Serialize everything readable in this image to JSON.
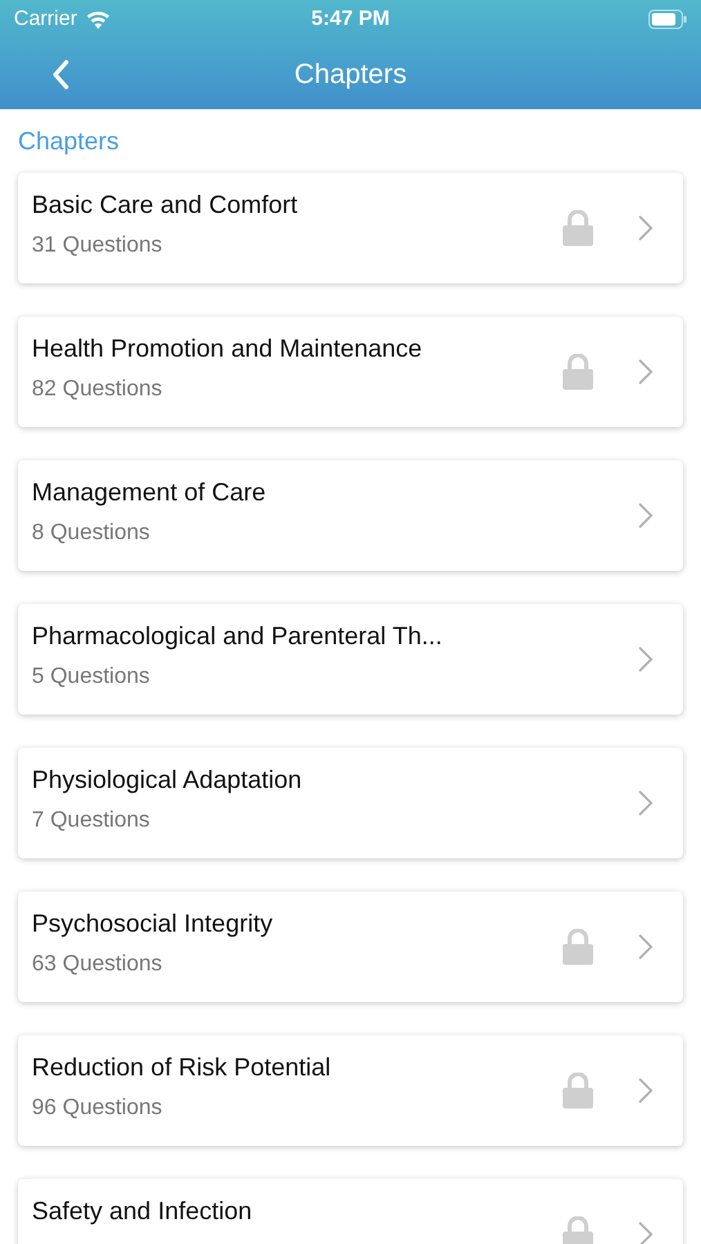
{
  "status_bar": {
    "carrier": "Carrier",
    "time": "5:47 PM"
  },
  "nav": {
    "title": "Chapters"
  },
  "section_title": "Chapters",
  "chapters": [
    {
      "title": "Basic Care and Comfort",
      "count": "31 Questions",
      "locked": true
    },
    {
      "title": "Health Promotion and Maintenance",
      "count": "82 Questions",
      "locked": true
    },
    {
      "title": "Management of Care",
      "count": "8 Questions",
      "locked": false
    },
    {
      "title": "Pharmacological and Parenteral Th...",
      "count": "5 Questions",
      "locked": false
    },
    {
      "title": "Physiological Adaptation",
      "count": "7 Questions",
      "locked": false
    },
    {
      "title": "Psychosocial Integrity",
      "count": "63 Questions",
      "locked": true
    },
    {
      "title": "Reduction of Risk Potential",
      "count": "96 Questions",
      "locked": true
    },
    {
      "title": "Safety and Infection",
      "locked": true
    }
  ]
}
